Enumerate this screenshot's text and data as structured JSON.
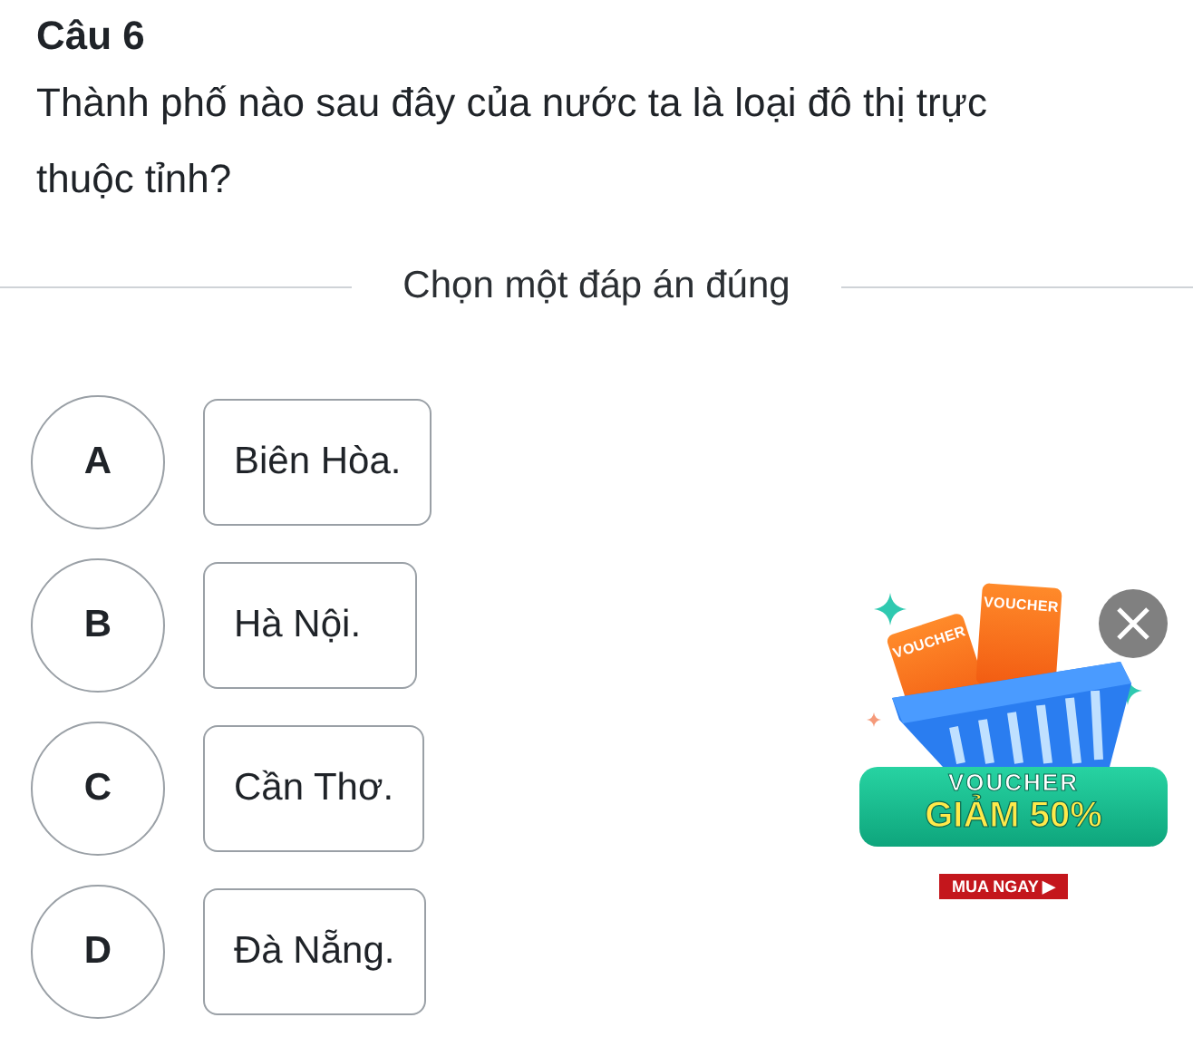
{
  "question": {
    "title": "Câu 6",
    "text": "Thành phố nào sau đây của nước ta là loại đô thị trực thuộc tỉnh?"
  },
  "instruction": "Chọn một đáp án đúng",
  "options": [
    {
      "letter": "A",
      "text": "Biên Hòa.",
      "selected": false
    },
    {
      "letter": "B",
      "text": "Hà Nội.",
      "selected": false
    },
    {
      "letter": "C",
      "text": "Cần Thơ.",
      "selected": false
    },
    {
      "letter": "D",
      "text": "Đà Nẵng.",
      "selected": false
    }
  ],
  "ad": {
    "ticket_labels": [
      "VOUCHER",
      "VOUCHER"
    ],
    "heading": "VOUCHER",
    "offer": "GIẢM 50%",
    "cta": "MUA NGAY ▶"
  }
}
